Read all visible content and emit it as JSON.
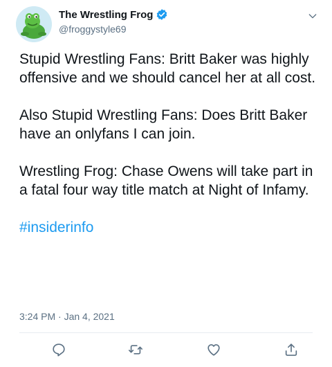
{
  "author": {
    "display_name": "The Wrestling Frog",
    "handle": "@froggystyle69",
    "verified": true
  },
  "tweet": {
    "paragraphs": [
      "Stupid Wrestling Fans: Britt Baker was highly offensive and we should cancel her at all cost.",
      "Also Stupid Wrestling Fans: Does Britt Baker have an onlyfans I can join.",
      "Wrestling Frog: Chase Owens will take part in a fatal four way title match at Night of Infamy."
    ],
    "hashtag": "#insiderinfo",
    "timestamp": "3:24 PM · Jan 4, 2021"
  },
  "actions": {
    "reply_icon": "reply-icon",
    "retweet_icon": "retweet-icon",
    "like_icon": "like-icon",
    "share_icon": "share-icon"
  },
  "colors": {
    "accent": "#1d9bf0",
    "secondary_text": "#5b7083",
    "divider": "#e6ecf0"
  }
}
